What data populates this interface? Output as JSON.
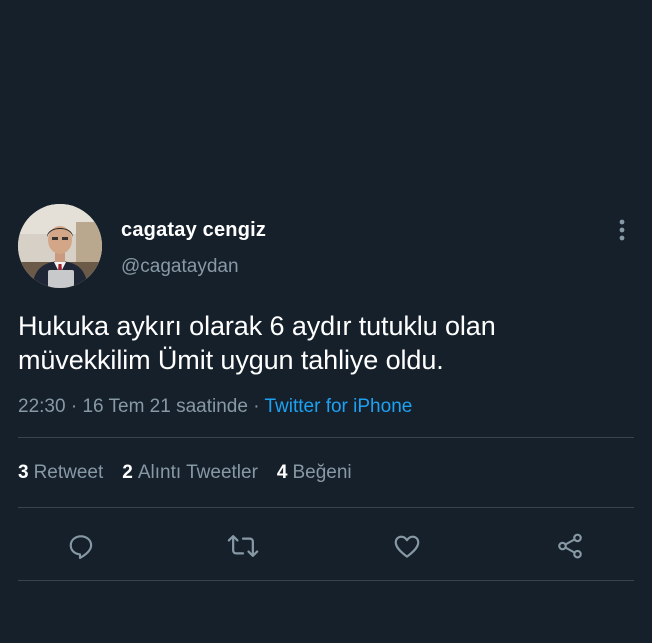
{
  "tweet": {
    "display_name": "cagatay cengiz",
    "handle": "@cagataydan",
    "text": "Hukuka aykırı olarak 6 aydır tutuklu olan müvekkilim Ümit uygun tahliye oldu.",
    "time": "22:30",
    "separator": " · ",
    "date": "16 Tem 21 saatinde",
    "separator2": " · ",
    "source": "Twitter for iPhone"
  },
  "stats": {
    "retweets": {
      "count": "3",
      "label": "Retweet"
    },
    "quotes": {
      "count": "2",
      "label": "Alıntı Tweetler"
    },
    "likes": {
      "count": "4",
      "label": "Beğeni"
    }
  },
  "actions": {
    "reply_icon": "reply-icon",
    "retweet_icon": "retweet-icon",
    "like_icon": "heart-icon",
    "share_icon": "share-icon",
    "more_icon": "more-vertical-icon"
  },
  "colors": {
    "background": "#15202b",
    "text_primary": "#ffffff",
    "text_secondary": "#8899a6",
    "link": "#1da1f2",
    "divider": "#38444d"
  }
}
